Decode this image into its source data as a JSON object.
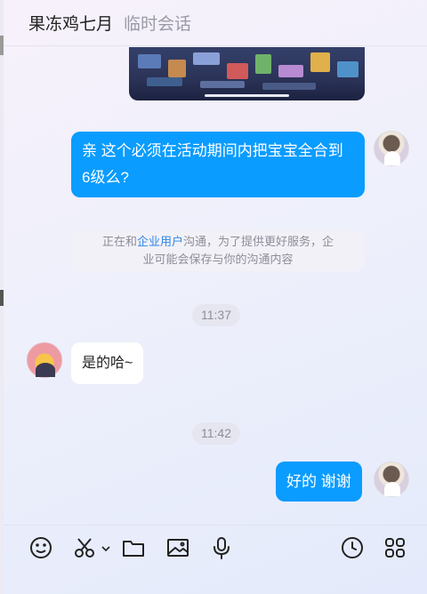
{
  "header": {
    "contact_name": "果冻鸡七月",
    "subtitle": "临时会话"
  },
  "messages": [
    {
      "type": "image",
      "direction": "outgoing",
      "description_icon": "game-screenshot"
    },
    {
      "type": "text",
      "direction": "outgoing",
      "lines": [
        "亲 这个必须在活动期间内把宝宝全合到",
        "6级么?"
      ]
    },
    {
      "type": "notice",
      "before": "正在和",
      "link": "企业用户",
      "after_line1": "沟通，为了提供更好服务，企",
      "line2": "业可能会保存与你的沟通内容"
    },
    {
      "type": "time",
      "text": "11:37"
    },
    {
      "type": "text",
      "direction": "incoming",
      "text": "是的哈~"
    },
    {
      "type": "time",
      "text": "11:42"
    },
    {
      "type": "text",
      "direction": "outgoing",
      "text": "好的 谢谢"
    }
  ],
  "toolbar": {
    "left_icons": [
      "emoji-icon",
      "scissors-icon",
      "chevron-down-icon",
      "folder-icon",
      "image-icon",
      "microphone-icon"
    ],
    "right_icons": [
      "clock-icon",
      "apps-icon"
    ]
  },
  "colors": {
    "outgoing_bubble": "#0a9cff",
    "incoming_bubble": "#ffffff",
    "notice_link": "#2f86e6"
  }
}
